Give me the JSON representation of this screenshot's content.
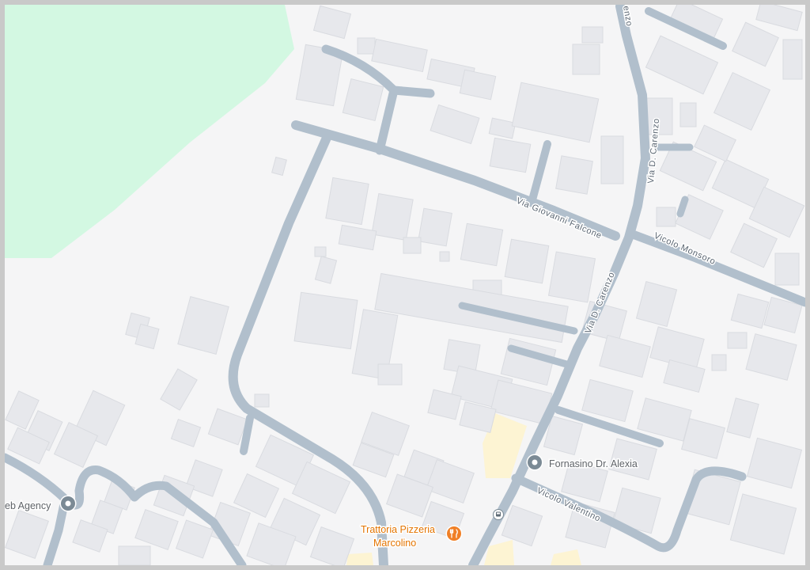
{
  "map": {
    "streets": {
      "giovanni_falcone": "Via Giovanni Falcone",
      "carenzo_upper": "Via D. Carenzo",
      "carenzo_lower": "Via D. Carenzo",
      "carenzo_top_fragment": "enzo",
      "monsoro": "Vicolo Monsoro",
      "valentino": "Vicolo Valentino"
    },
    "pois": {
      "fornasino": {
        "name": "Fornasino Dr. Alexia",
        "icon": "map-pin-icon"
      },
      "web_agency": {
        "name": "eb Agency",
        "icon": "map-pin-icon"
      },
      "trattoria": {
        "name_line1": "Trattoria Pizzeria",
        "name_line2": "Marcolino",
        "icon": "restaurant-icon"
      },
      "bus_stop": {
        "icon": "bus-stop-icon"
      }
    },
    "colors": {
      "background": "#f5f5f6",
      "park": "#d3f8e2",
      "road": "#b1bfcc",
      "building": "#e7e8ec",
      "commercial": "#fdf4d3",
      "poi_pin": "#7b8a95",
      "restaurant": "#f07f26"
    }
  }
}
